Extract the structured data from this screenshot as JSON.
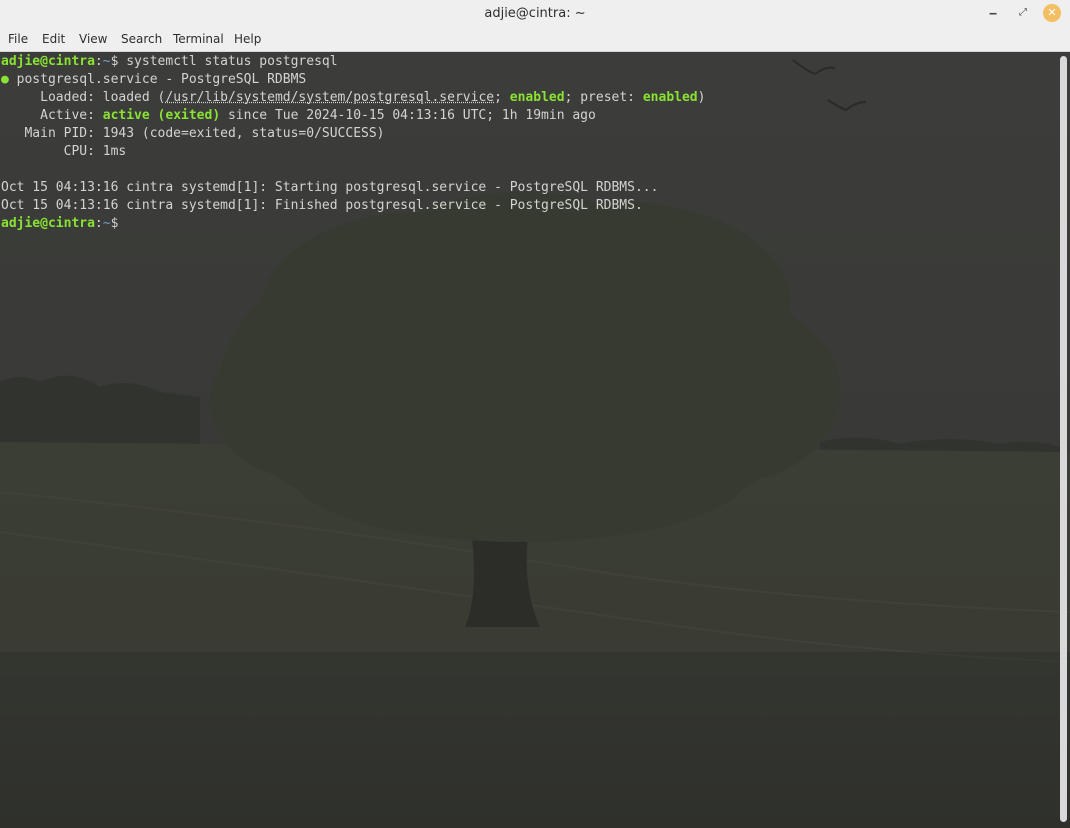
{
  "window": {
    "title": "adjie@cintra: ~"
  },
  "menu": [
    "File",
    "Edit",
    "View",
    "Search",
    "Terminal",
    "Help"
  ],
  "terminal": {
    "prompt_user": "adjie@cintra",
    "prompt_sep": ":",
    "prompt_path": "~",
    "prompt_sym": "$ ",
    "command": "systemctl status postgresql",
    "bullet": "●",
    "service_line": " postgresql.service - PostgreSQL RDBMS",
    "loaded_label": "     Loaded: ",
    "loaded_pre": "loaded (",
    "loaded_path": "/usr/lib/systemd/system/postgresql.service",
    "loaded_sep1": "; ",
    "enabled1": "enabled",
    "loaded_sep2": "; preset: ",
    "enabled2": "enabled",
    "loaded_close": ")",
    "active_label": "     Active: ",
    "active_status": "active (exited)",
    "active_rest": " since Tue 2024-10-15 04:13:16 UTC; 1h 19min ago",
    "pid_line": "   Main PID: 1943 (code=exited, status=0/SUCCESS)",
    "cpu_line": "        CPU: 1ms",
    "log1": "Oct 15 04:13:16 cintra systemd[1]: Starting postgresql.service - PostgreSQL RDBMS...",
    "log2": "Oct 15 04:13:16 cintra systemd[1]: Finished postgresql.service - PostgreSQL RDBMS."
  },
  "icons": {
    "minimize": "minimize-icon",
    "maximize": "maximize-icon",
    "close": "close-icon"
  },
  "colors": {
    "prompt_green": "#8ae234",
    "path_blue": "#729fcf",
    "close_button": "#f2c063"
  }
}
